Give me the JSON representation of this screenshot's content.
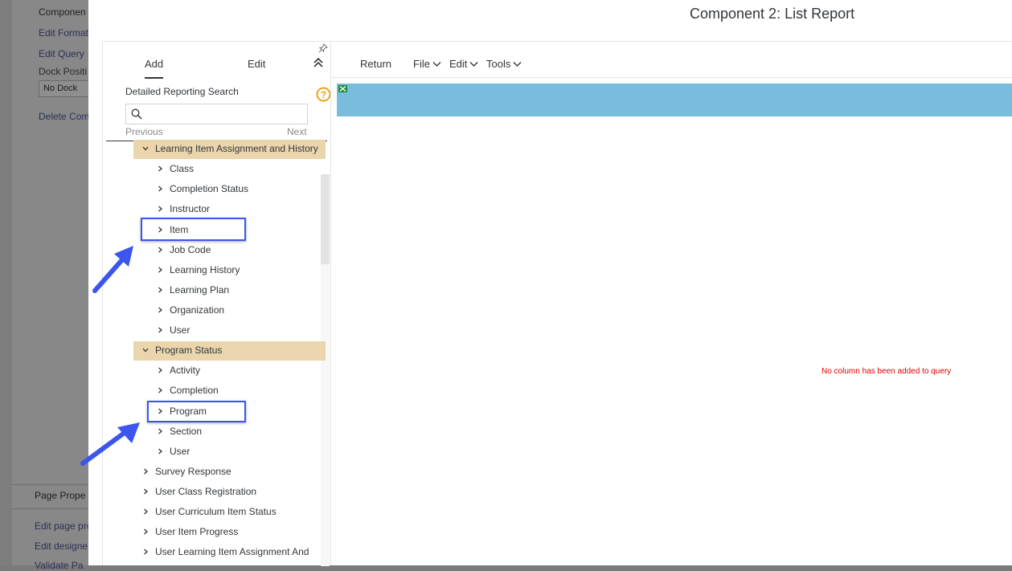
{
  "background": {
    "labels": {
      "component_header": "Componen",
      "edit_format": "Edit Format",
      "edit_query": "Edit Query",
      "dock_position": "Dock Positi",
      "dock_select": "No Dock",
      "delete_component": "Delete Com",
      "page_properties": "Page Prope",
      "edit_page_properties": "Edit page pro",
      "edit_designer": "Edit designe",
      "validate": "Validate Pa"
    }
  },
  "dialog": {
    "title": "Component 2: List Report"
  },
  "left_panel": {
    "tabs": {
      "add": "Add",
      "edit": "Edit"
    },
    "search": {
      "label": "Detailed Reporting Search",
      "placeholder": "",
      "previous": "Previous",
      "next": "Next"
    },
    "tree": {
      "category_1": "Learning Item Assignment and History",
      "cat1_items": [
        "Class",
        "Completion Status",
        "Instructor",
        "Item",
        "Job Code",
        "Learning History",
        "Learning Plan",
        "Organization",
        "User"
      ],
      "category_2": "Program Status",
      "cat2_items": [
        "Activity",
        "Completion",
        "Program",
        "Section",
        "User"
      ],
      "other_categories": [
        "Survey Response",
        "User Class Registration",
        "User Curriculum Item Status",
        "User Item Progress",
        "User Learning Item Assignment And"
      ]
    }
  },
  "toolbar": {
    "return": "Return",
    "file": "File",
    "edit": "Edit",
    "tools": "Tools"
  },
  "content": {
    "empty_message": "No column has been added to query"
  },
  "colors": {
    "category_highlight": "#ebd5ad",
    "annotation_blue": "#3b55ee",
    "result_bar": "#79bcdc",
    "error_text": "#e00000",
    "help_orange": "#e8a317"
  }
}
